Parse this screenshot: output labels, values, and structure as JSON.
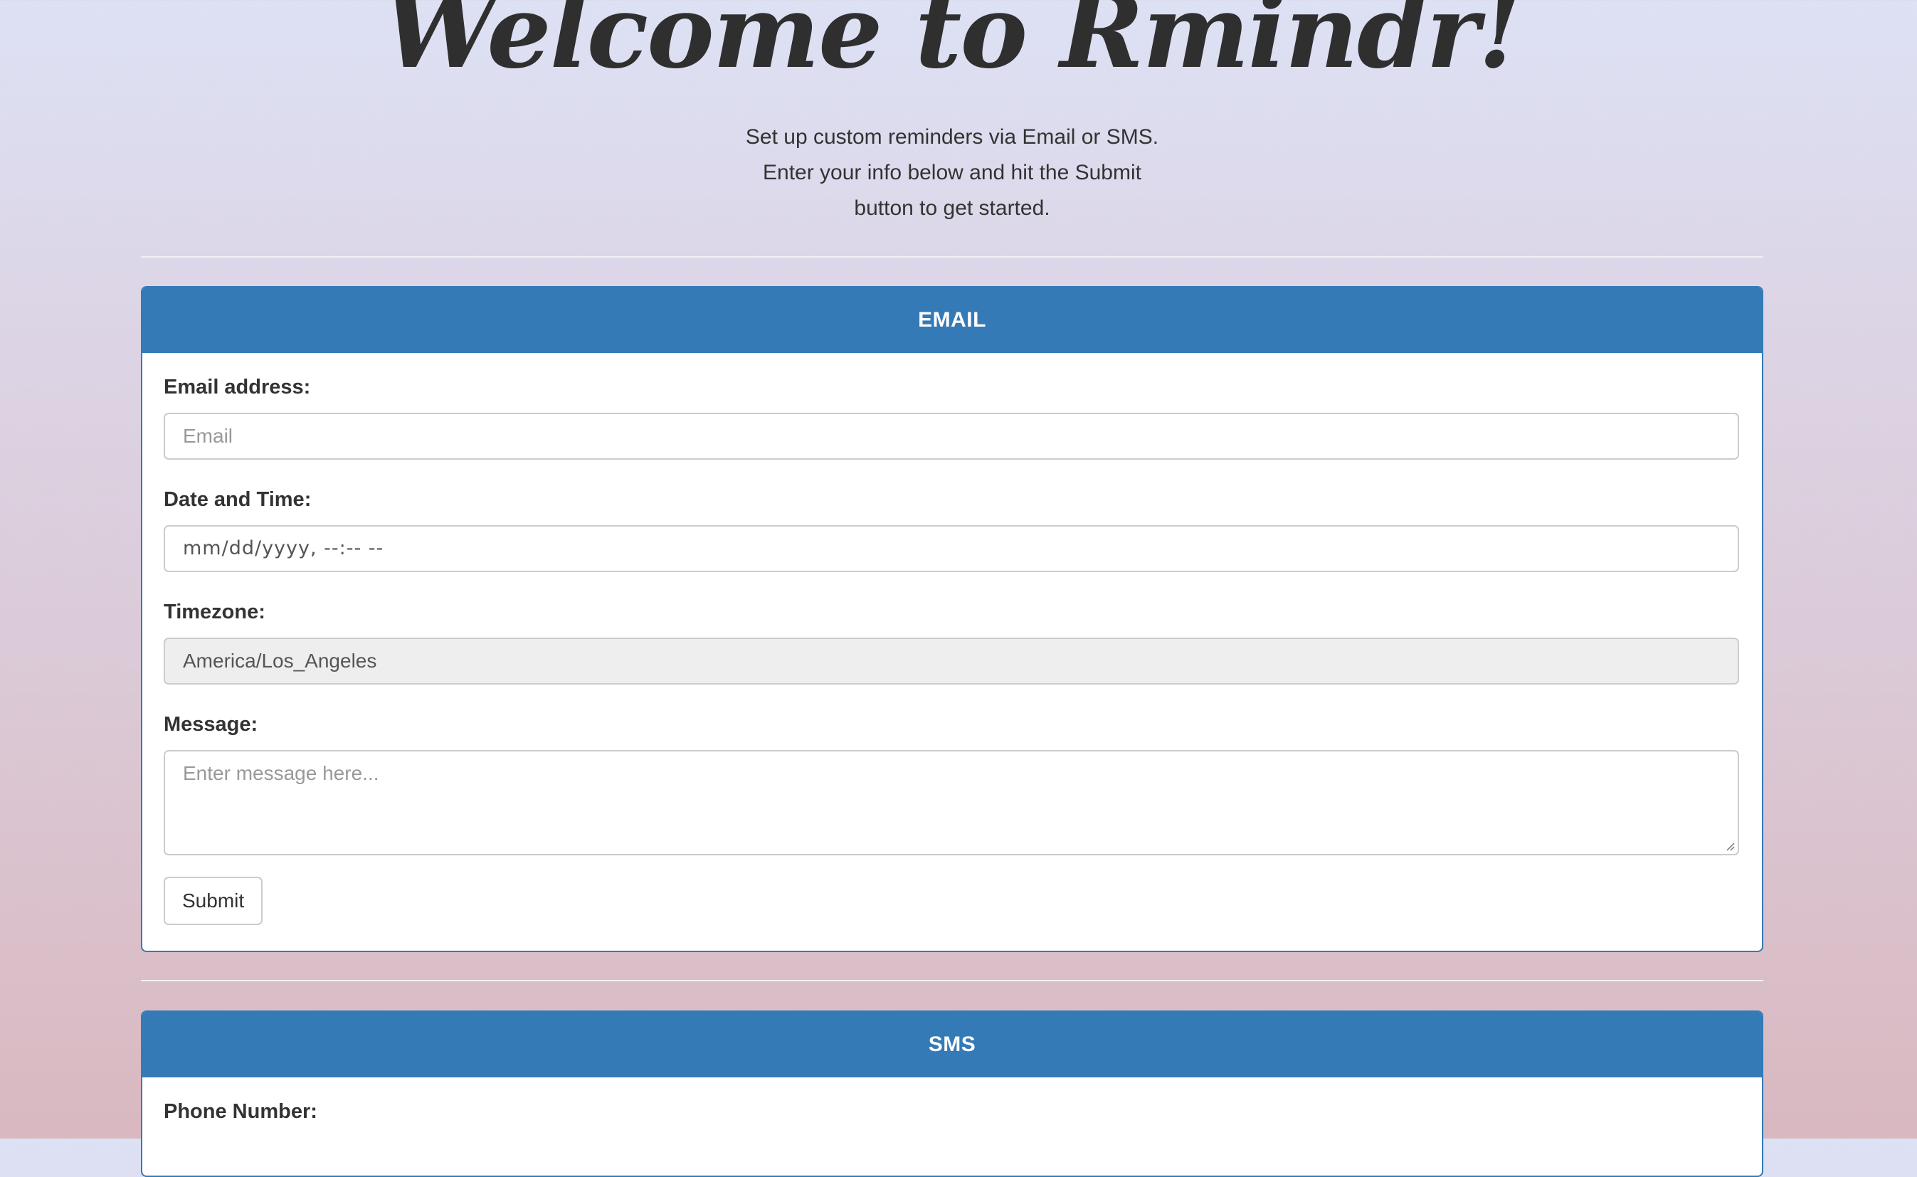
{
  "hero": {
    "title": "Welcome to Rmindr!",
    "intro_lines": [
      "Set up custom reminders via Email or SMS.",
      "Enter your info below and hit the Submit",
      "button to get started."
    ]
  },
  "email_panel": {
    "heading": "EMAIL",
    "email_label": "Email address:",
    "email_placeholder": "Email",
    "datetime_label": "Date and Time:",
    "datetime_placeholder": "mm/dd/yyyy, --:-- --",
    "timezone_label": "Timezone:",
    "timezone_value": "America/Los_Angeles",
    "message_label": "Message:",
    "message_placeholder": "Enter message here...",
    "submit_label": "Submit"
  },
  "sms_panel": {
    "heading": "SMS",
    "phone_label": "Phone Number:"
  },
  "colors": {
    "panel_primary": "#337ab7",
    "input_border": "#cccccc",
    "readonly_bg": "#eeeeee"
  }
}
